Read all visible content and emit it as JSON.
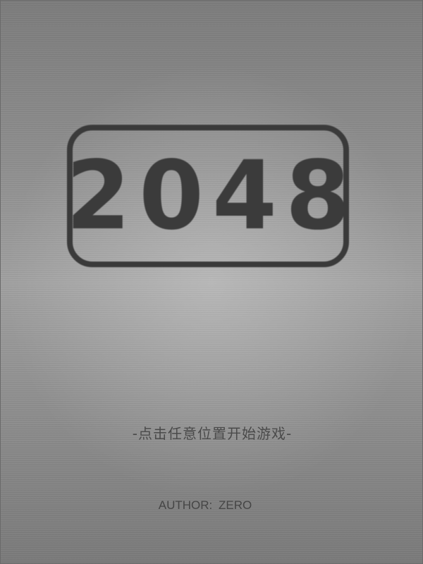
{
  "game": {
    "logo_text": "2048",
    "start_prompt": "-点击任意位置开始游戏-",
    "author": "AUTHOR:  ZERO"
  },
  "colors": {
    "background": "#8f8f8f",
    "logo": "#3a3a3a",
    "text": "#4a4a4a"
  }
}
